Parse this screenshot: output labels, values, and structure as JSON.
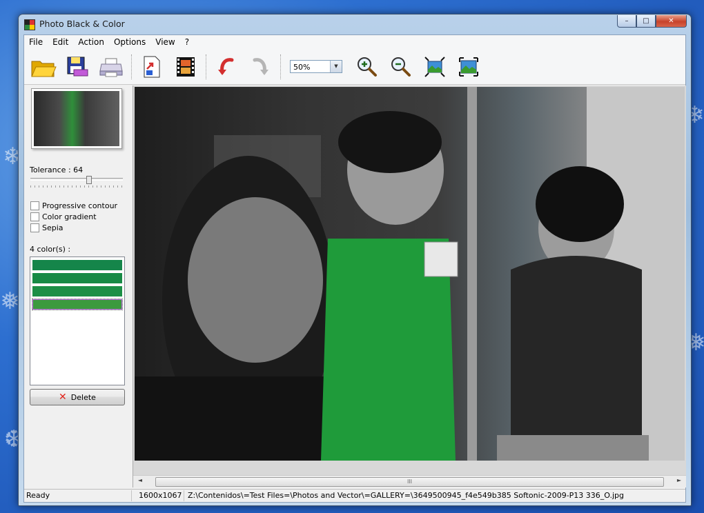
{
  "window": {
    "title": "Photo Black & Color"
  },
  "caption_buttons": {
    "minimize": "–",
    "maximize": "□",
    "close": "✕"
  },
  "menu": [
    "File",
    "Edit",
    "Action",
    "Options",
    "View",
    "?"
  ],
  "toolbar": {
    "zoom_value": "50%",
    "icons": [
      "open-folder-icon",
      "save-icon",
      "print-icon",
      "export-icon",
      "filmstrip-icon",
      "undo-icon",
      "redo-icon",
      "zoom-in-icon",
      "zoom-out-icon",
      "fit-window-icon",
      "actual-size-icon"
    ]
  },
  "side": {
    "tolerance_label": "Tolerance : 64",
    "tolerance_value": 64,
    "checkboxes": [
      {
        "label": "Progressive contour",
        "checked": false
      },
      {
        "label": "Color gradient",
        "checked": false
      },
      {
        "label": "Sepia",
        "checked": false
      }
    ],
    "colors_label": "4 color(s) :",
    "colors": [
      "#15854a",
      "#178a45",
      "#1c8f46",
      "#3c9a3e"
    ],
    "delete_label": "Delete"
  },
  "status": {
    "state": "Ready",
    "dimensions": "1600x1067",
    "path": "Z:\\Contenidos\\=Test Files=\\Photos and Vector\\=GALLERY=\\3649500945_f4e549b385 Softonic-2009-P13 336_O.jpg"
  },
  "scroll": {
    "grip": "III"
  }
}
